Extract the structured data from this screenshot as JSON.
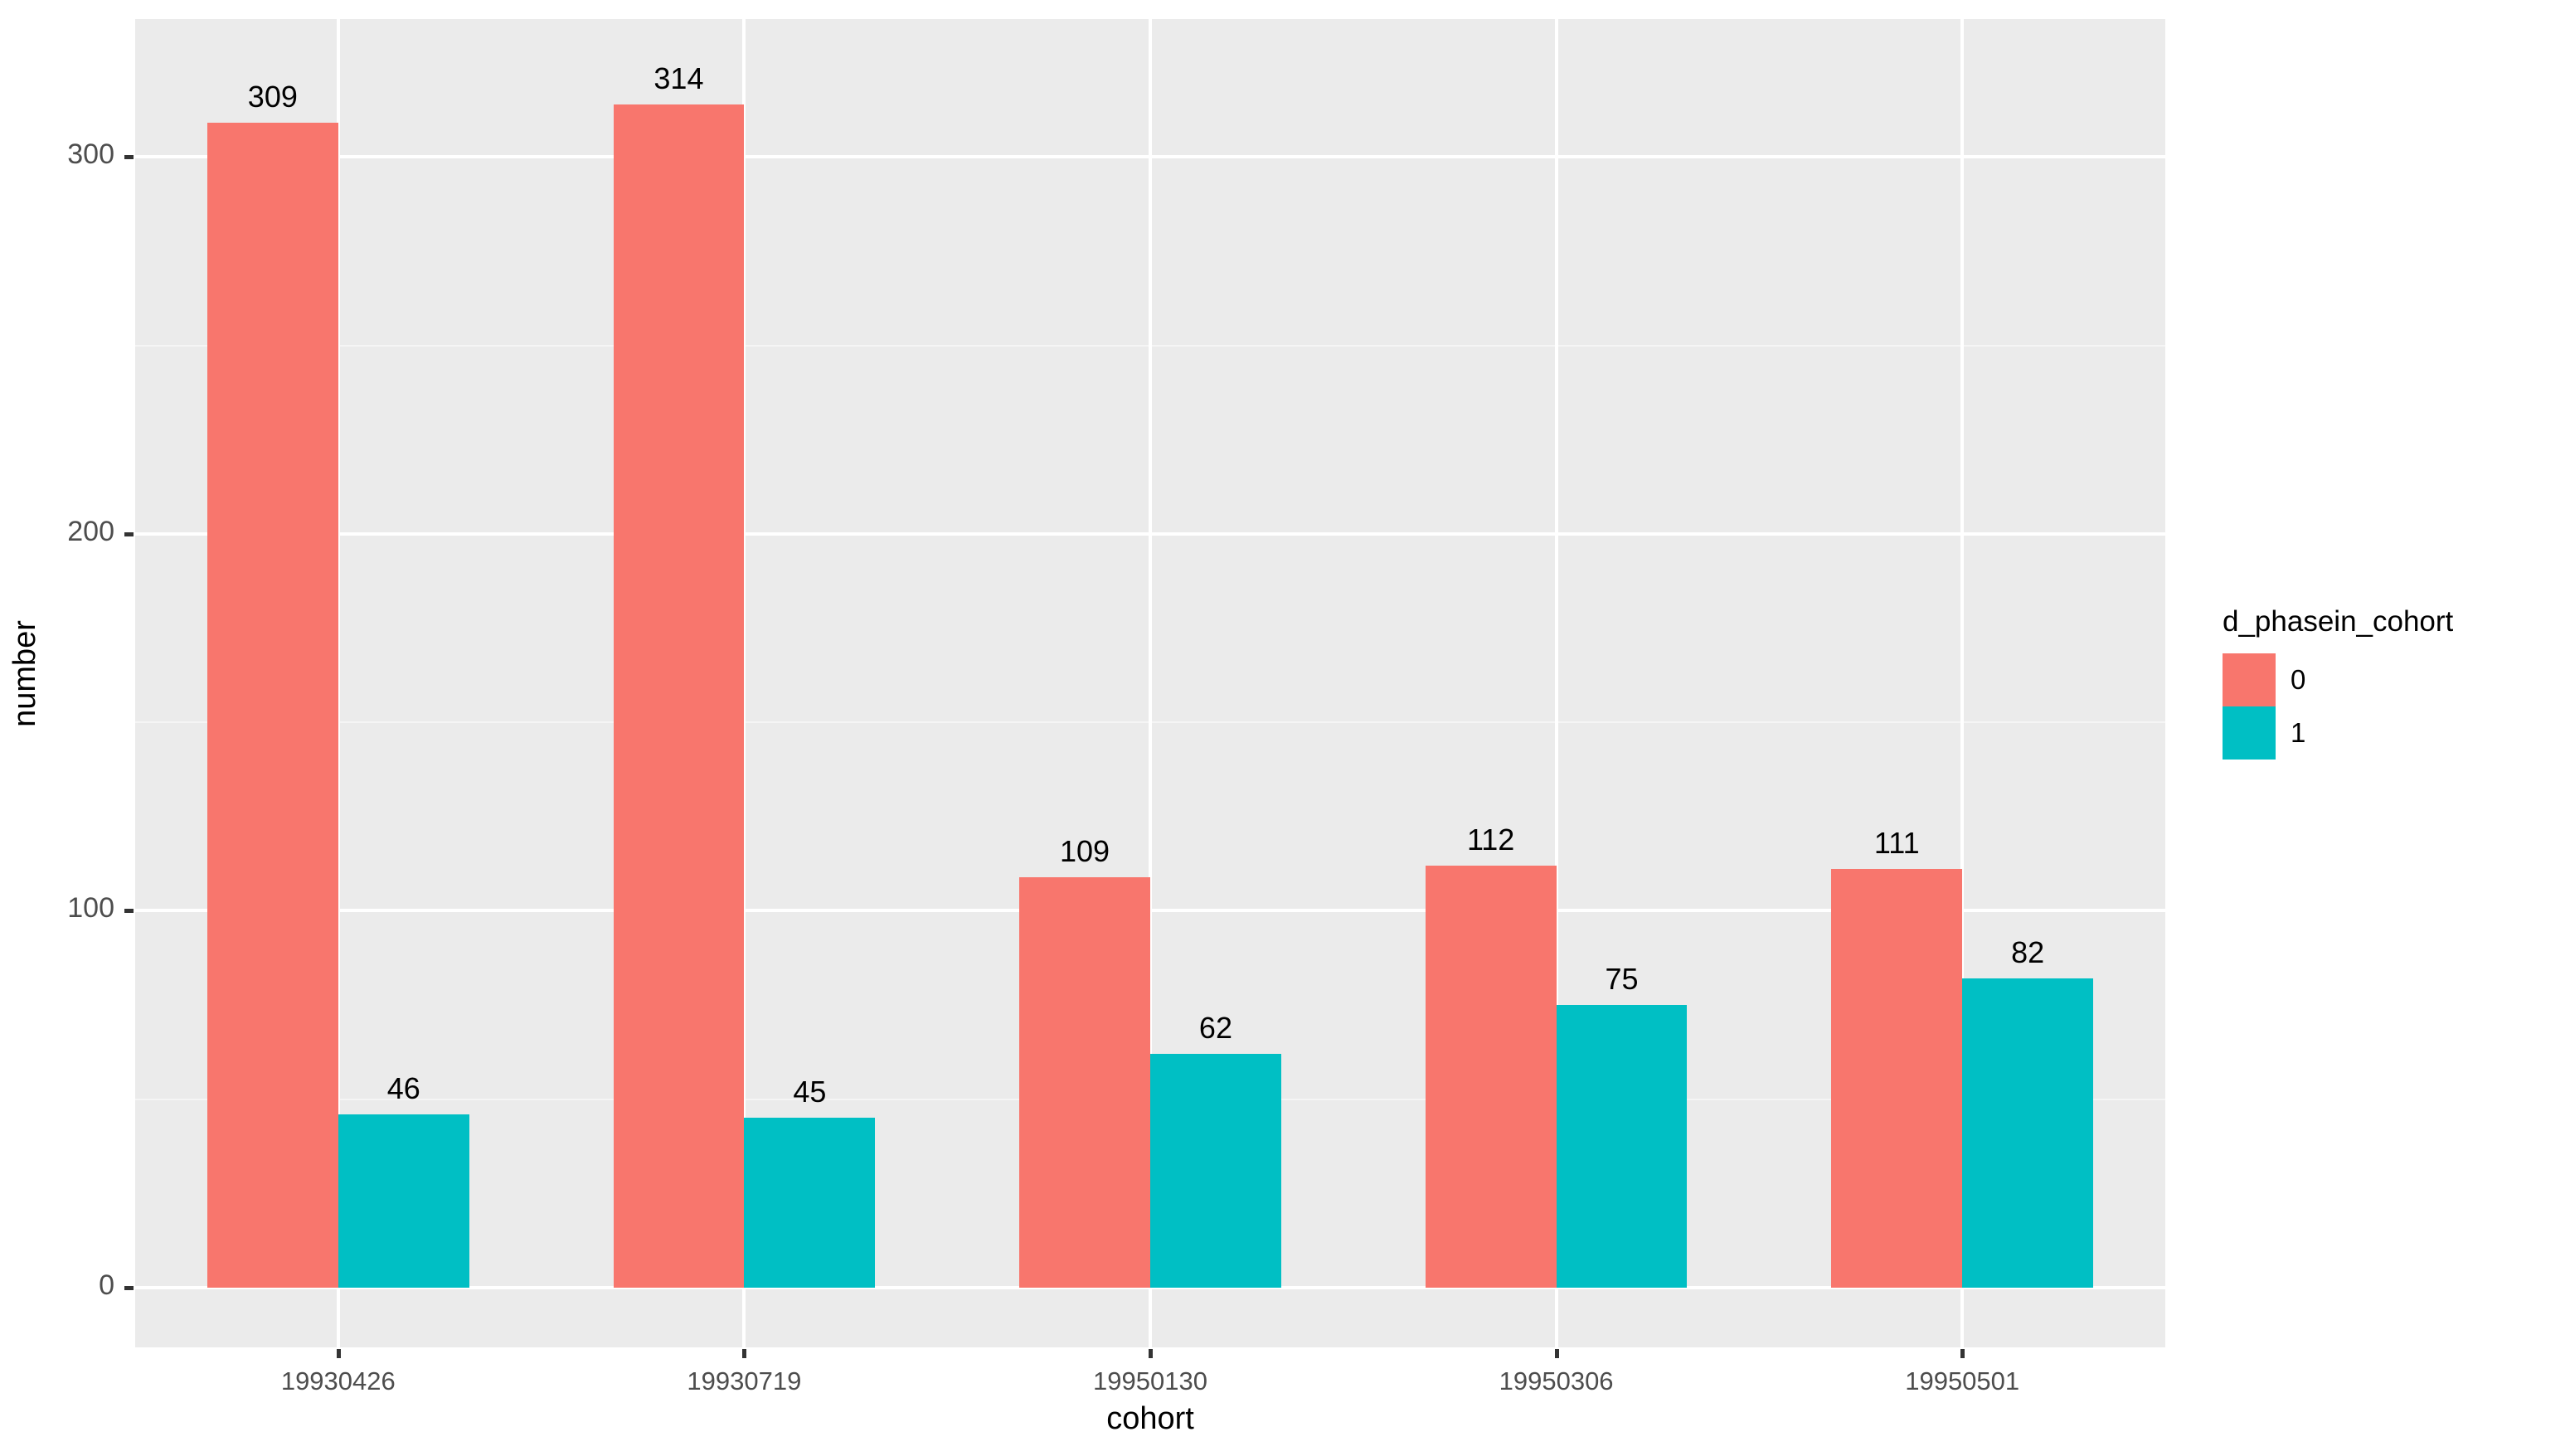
{
  "chart_data": {
    "type": "bar",
    "title": "",
    "subtitle": "",
    "xlabel": "cohort",
    "ylabel": "number",
    "categories": [
      "19930426",
      "19930719",
      "19950130",
      "19950306",
      "19950501"
    ],
    "series": [
      {
        "name": "0",
        "color": "#f8766d",
        "values": [
          309,
          314,
          109,
          112,
          111
        ]
      },
      {
        "name": "1",
        "color": "#00bfc4",
        "values": [
          46,
          45,
          62,
          75,
          82
        ]
      }
    ],
    "legend": {
      "title": "d_phasein_cohort",
      "position": "right",
      "entries": [
        {
          "label": "0",
          "color": "#f8766d"
        },
        {
          "label": "1",
          "color": "#00bfc4"
        }
      ]
    },
    "y_axis": {
      "ticks": [
        0,
        100,
        200,
        300
      ],
      "tick_labels": [
        "0",
        "100",
        "200",
        "300"
      ],
      "minor_ticks": [
        50,
        150,
        250
      ],
      "ylim": [
        0,
        330
      ]
    },
    "x_axis": {
      "tick_labels": [
        "19930426",
        "19930719",
        "19950130",
        "19950306",
        "19950501"
      ]
    },
    "grid": {
      "major_color": "#ffffff",
      "minor_color": "#f5f5f5",
      "panel_background": "#ebebeb",
      "enabled": true
    },
    "data_labels": [
      309,
      46,
      314,
      45,
      109,
      62,
      112,
      75,
      111,
      82
    ],
    "bar_mode": "dodge"
  }
}
